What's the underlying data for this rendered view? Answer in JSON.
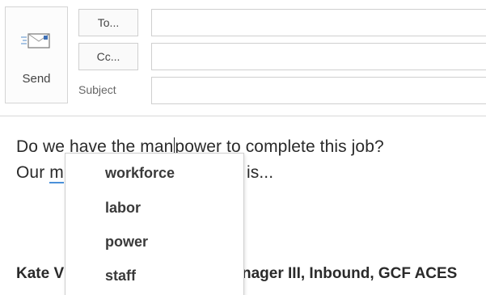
{
  "compose": {
    "send_label": "Send",
    "to_label": "To...",
    "cc_label": "Cc...",
    "subject_label": "Subject"
  },
  "body": {
    "line1_before": "Do we have the ",
    "line1_word_a": "man",
    "line1_word_b": "power",
    "line1_after": " to complete this job?",
    "line2_start": "Our ",
    "line2_word": "m",
    "line2_end": "is..."
  },
  "signature": {
    "left": "Kate V",
    "right": "nager III, Inbound, GCF ACES"
  },
  "suggestions": [
    "workforce",
    "labor",
    "power",
    "staff"
  ],
  "colors": {
    "spellcheck_underline": "#4a90d9",
    "border": "#cfcfcf"
  }
}
